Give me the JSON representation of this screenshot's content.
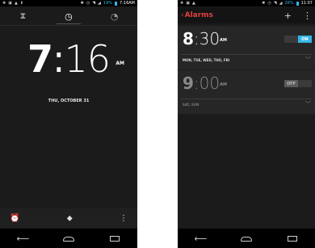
{
  "clock_screen": {
    "status_bar": {
      "battery": "19%",
      "time": "7:16",
      "ampm_small": "AM"
    },
    "tabs": [
      {
        "icon": "hourglass-icon",
        "active": false
      },
      {
        "icon": "clock-icon",
        "active": true
      },
      {
        "icon": "stopwatch-icon",
        "active": false
      }
    ],
    "time": {
      "hours": "7",
      "colon": ":",
      "minutes": "16",
      "ampm": "AM"
    },
    "date": "THU, OCTOBER 31",
    "bottom_bar": {
      "alarm_icon": "alarm-icon",
      "location_icon": "location-pin-icon",
      "menu_icon": "overflow-menu-icon"
    }
  },
  "alarms_screen": {
    "status_bar": {
      "battery": "26%",
      "time": "11:07"
    },
    "title": "Alarms",
    "alarms": [
      {
        "hours": "8",
        "colon": ":",
        "minutes": "30",
        "ampm": "AM",
        "toggle": "ON",
        "enabled": true,
        "days": "MON, TUE, WED, THU, FRI"
      },
      {
        "hours": "9",
        "colon": ":",
        "minutes": "00",
        "ampm": "AM",
        "toggle": "OFF",
        "enabled": false,
        "days": "SAT, SUN"
      }
    ]
  },
  "colors": {
    "accent_blue": "#33b5e5",
    "accent_red": "#e04040",
    "background": "#1b1b1b"
  }
}
